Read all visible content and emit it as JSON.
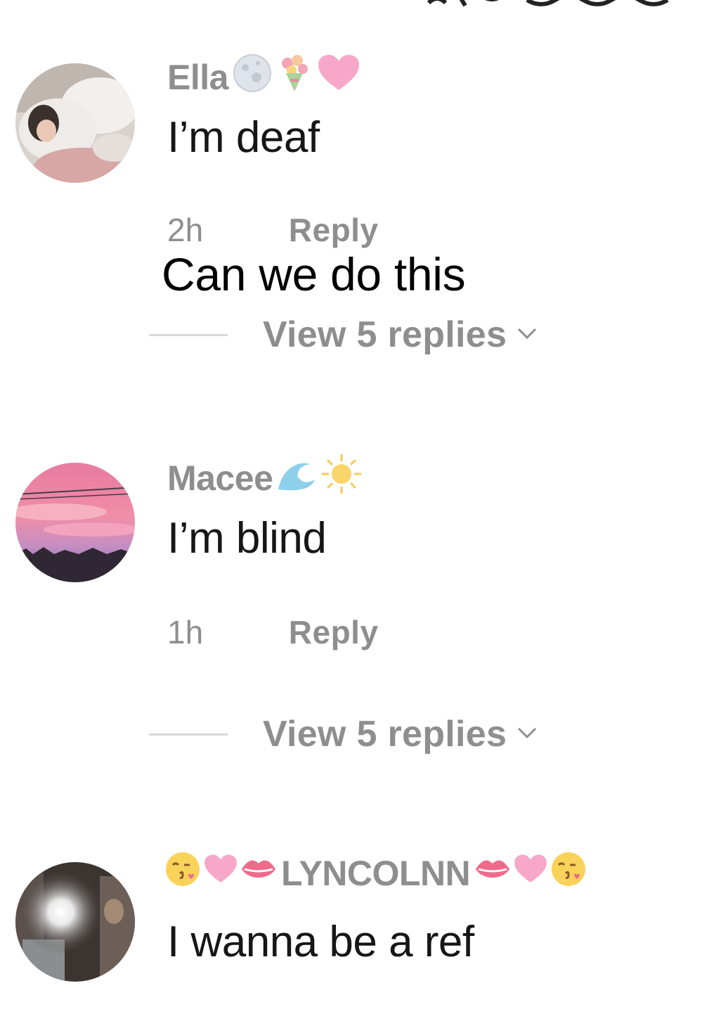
{
  "overlay_caption": "Can we do this",
  "comments": [
    {
      "username": "Ella",
      "username_emojis": [
        "moon-icon",
        "bouquet-icon",
        "pink-heart-icon"
      ],
      "text": "I’m deaf",
      "time": "2h",
      "reply_label": "Reply",
      "view_replies_label": "View 5 replies"
    },
    {
      "username": "Macee",
      "username_emojis": [
        "wave-icon",
        "sun-icon"
      ],
      "text": "I’m blind",
      "time": "1h",
      "reply_label": "Reply",
      "view_replies_label": "View 5 replies"
    },
    {
      "username": "LYNCOLNN",
      "username_emojis_before": [
        "kissing-face-icon",
        "pink-heart-icon",
        "lips-icon"
      ],
      "username_emojis_after": [
        "lips-icon",
        "pink-heart-icon",
        "kissing-face-icon"
      ],
      "text": "I wanna be a ref"
    }
  ],
  "colors": {
    "muted_text": "#8e8e8e",
    "body_text": "#161616",
    "divider": "#d9d9d9",
    "heart_pink": "#f7a8c8",
    "lips_red": "#f06a8a",
    "face_yellow": "#f9d25a"
  }
}
